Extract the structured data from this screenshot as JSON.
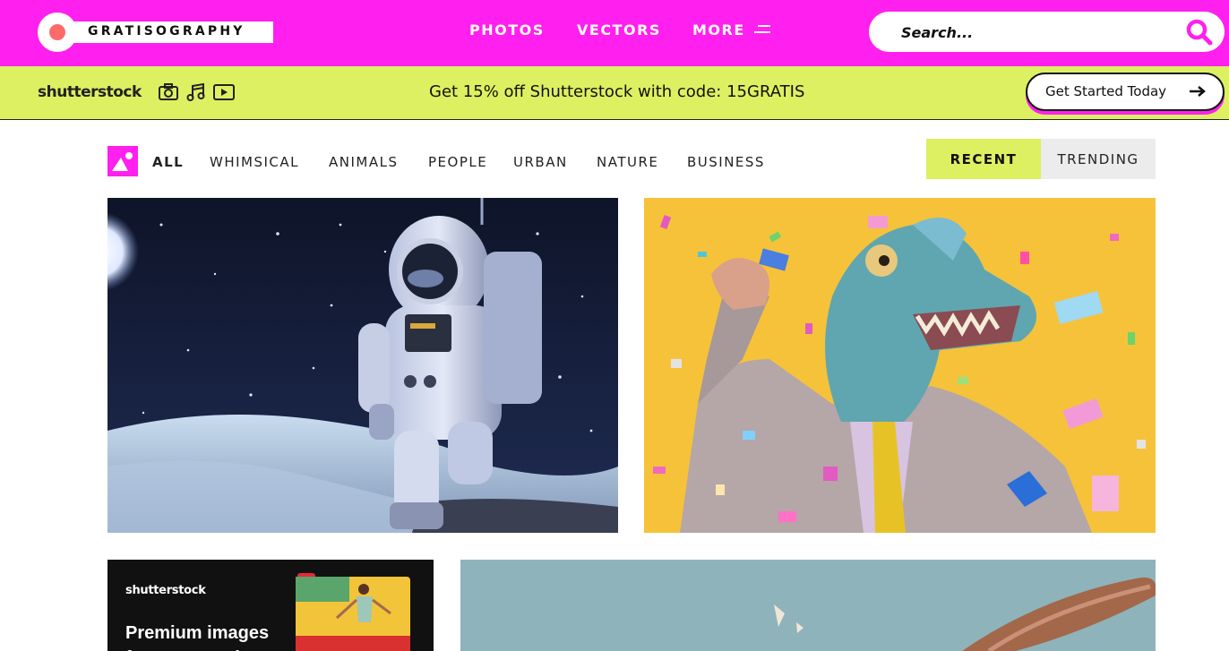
{
  "header": {
    "logo_text": "GRATISOGRAPHY",
    "nav": {
      "photos": "PHOTOS",
      "vectors": "VECTORS",
      "more": "MORE"
    },
    "search": {
      "placeholder": "Search..."
    },
    "colors": {
      "brand": "#ff1fef",
      "promo": "#ddf061"
    }
  },
  "promo": {
    "logo": "shutterstock",
    "icons": [
      "camera-icon",
      "music-note-icon",
      "video-play-icon"
    ],
    "text": "Get 15% off Shutterstock with code: 15GRATIS",
    "button_label": "Get Started Today"
  },
  "filters": {
    "categories": [
      "ALL",
      "WHIMSICAL",
      "ANIMALS",
      "PEOPLE",
      "URBAN",
      "NATURE",
      "BUSINESS"
    ],
    "active": "ALL",
    "sort_tabs": {
      "recent": "RECENT",
      "trending": "TRENDING"
    },
    "active_sort": "RECENT"
  },
  "gallery": {
    "items": [
      "astronaut-photo",
      "dinosaur-businessman-photo",
      "baseball-bat-photo"
    ],
    "ad": {
      "logo": "shutterstock",
      "title": "Premium images for every project"
    }
  }
}
